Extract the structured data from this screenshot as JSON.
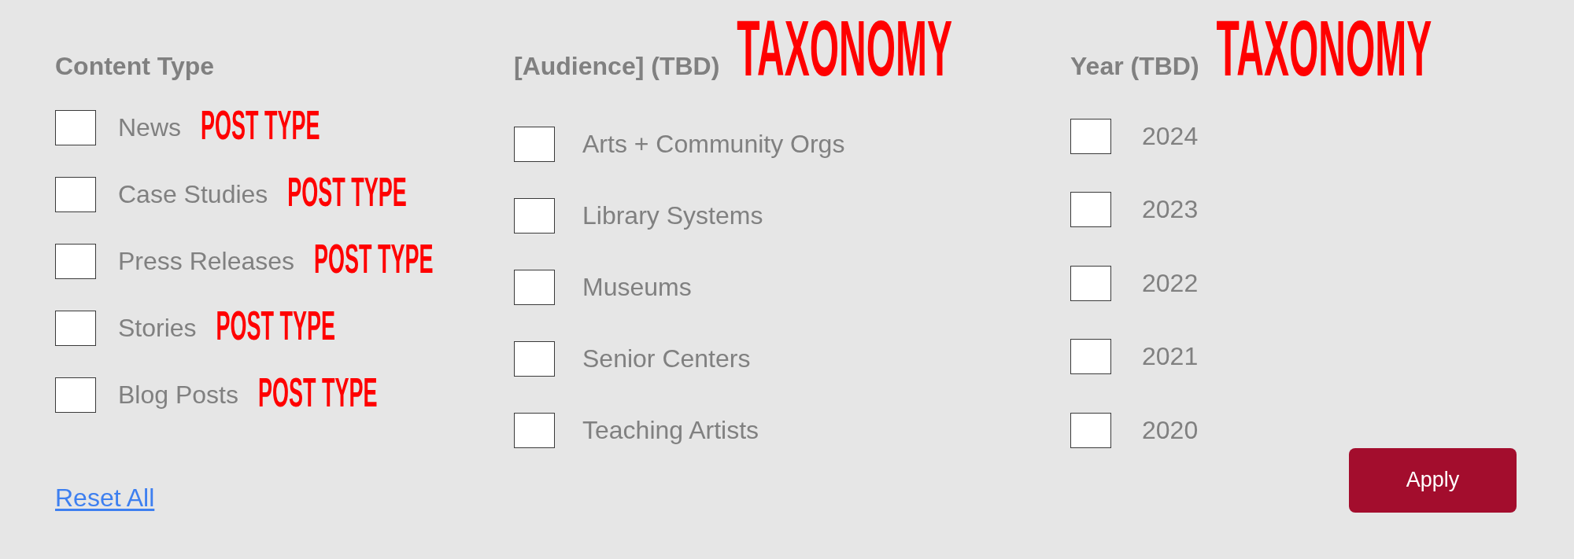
{
  "filter_groups": [
    {
      "heading": "Content Type",
      "options": [
        {
          "label": "News",
          "checked": false,
          "annotation": "POST TYPE"
        },
        {
          "label": "Case Studies",
          "checked": false,
          "annotation": "POST TYPE"
        },
        {
          "label": "Press Releases",
          "checked": false,
          "annotation": "POST TYPE"
        },
        {
          "label": "Stories",
          "checked": false,
          "annotation": "POST TYPE"
        },
        {
          "label": "Blog Posts",
          "checked": false,
          "annotation": "POST TYPE"
        }
      ]
    },
    {
      "heading": "[Audience] (TBD)",
      "annotation": "TAXONOMY",
      "options": [
        {
          "label": "Arts + Community Orgs",
          "checked": false
        },
        {
          "label": "Library Systems",
          "checked": false
        },
        {
          "label": "Museums",
          "checked": false
        },
        {
          "label": "Senior Centers",
          "checked": false
        },
        {
          "label": "Teaching Artists",
          "checked": false
        }
      ]
    },
    {
      "heading": "Year (TBD)",
      "annotation": "TAXONOMY",
      "options": [
        {
          "label": "2024",
          "checked": false
        },
        {
          "label": "2023",
          "checked": false
        },
        {
          "label": "2022",
          "checked": false
        },
        {
          "label": "2021",
          "checked": false
        },
        {
          "label": "2020",
          "checked": false
        }
      ]
    }
  ],
  "reset_link": "Reset All",
  "apply_button": "Apply"
}
